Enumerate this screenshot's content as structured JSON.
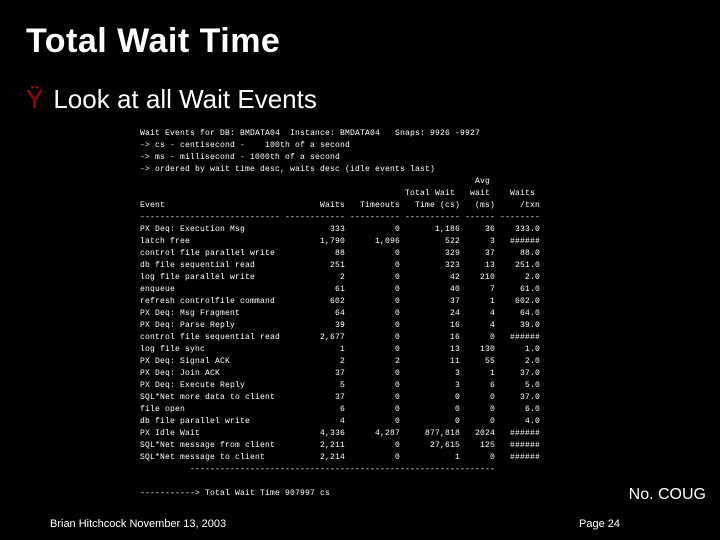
{
  "title": "Total Wait Time",
  "bullet": {
    "symbol": "Ÿ",
    "text": "Look at all Wait Events"
  },
  "report": {
    "header_lines": [
      "Wait Events for DB: BMDATA04  Instance: BMDATA04   Snaps: 9926 -9927",
      "-> cs - centisecond -    100th of a second",
      "-> ms - millisecond - 1000th of a second",
      "-> ordered by wait time desc, waits desc (idle events last)"
    ],
    "col_head1": "                                                                   Avg",
    "col_head2": "                                                     Total Wait   wait    Waits",
    "col_head3": "Event                               Waits   Timeouts   Time (cs)   (ms)     /txn",
    "col_sep": "---------------------------- ------------ ---------- ----------- ------ --------",
    "rows": [
      {
        "event": "PX Deq: Execution Msg",
        "waits": "333",
        "timeouts": "0",
        "total": "1,186",
        "avg": "36",
        "pertxn": "333.0"
      },
      {
        "event": "latch free",
        "waits": "1,790",
        "timeouts": "1,096",
        "total": "522",
        "avg": "3",
        "pertxn": "######"
      },
      {
        "event": "control file parallel write",
        "waits": "88",
        "timeouts": "0",
        "total": "329",
        "avg": "37",
        "pertxn": "88.0"
      },
      {
        "event": "db file sequential read",
        "waits": "251",
        "timeouts": "0",
        "total": "323",
        "avg": "13",
        "pertxn": "251.0"
      },
      {
        "event": "log file parallel write",
        "waits": "2",
        "timeouts": "0",
        "total": "42",
        "avg": "210",
        "pertxn": "2.0"
      },
      {
        "event": "enqueue",
        "waits": "61",
        "timeouts": "0",
        "total": "40",
        "avg": "7",
        "pertxn": "61.0"
      },
      {
        "event": "refresh controlfile command",
        "waits": "602",
        "timeouts": "0",
        "total": "37",
        "avg": "1",
        "pertxn": "602.0"
      },
      {
        "event": "PX Deq: Msg Fragment",
        "waits": "64",
        "timeouts": "0",
        "total": "24",
        "avg": "4",
        "pertxn": "64.0"
      },
      {
        "event": "PX Deq: Parse Reply",
        "waits": "39",
        "timeouts": "0",
        "total": "16",
        "avg": "4",
        "pertxn": "39.0"
      },
      {
        "event": "control file sequential read",
        "waits": "2,677",
        "timeouts": "0",
        "total": "16",
        "avg": "0",
        "pertxn": "######"
      },
      {
        "event": "log file sync",
        "waits": "1",
        "timeouts": "0",
        "total": "13",
        "avg": "130",
        "pertxn": "1.0"
      },
      {
        "event": "PX Deq: Signal ACK",
        "waits": "2",
        "timeouts": "2",
        "total": "11",
        "avg": "55",
        "pertxn": "2.0"
      },
      {
        "event": "PX Deq: Join ACK",
        "waits": "37",
        "timeouts": "0",
        "total": "3",
        "avg": "1",
        "pertxn": "37.0"
      },
      {
        "event": "PX Deq: Execute Reply",
        "waits": "5",
        "timeouts": "0",
        "total": "3",
        "avg": "6",
        "pertxn": "5.0"
      },
      {
        "event": "SQL*Net more data to client",
        "waits": "37",
        "timeouts": "0",
        "total": "0",
        "avg": "0",
        "pertxn": "37.0"
      },
      {
        "event": "file open",
        "waits": "6",
        "timeouts": "0",
        "total": "0",
        "avg": "0",
        "pertxn": "6.0"
      },
      {
        "event": "db file parallel write",
        "waits": "4",
        "timeouts": "0",
        "total": "0",
        "avg": "0",
        "pertxn": "4.0"
      },
      {
        "event": "PX Idle Wait",
        "waits": "4,336",
        "timeouts": "4,287",
        "total": "877,818",
        "avg": "2024",
        "pertxn": "######"
      },
      {
        "event": "SQL*Net message from client",
        "waits": "2,211",
        "timeouts": "0",
        "total": "27,615",
        "avg": "125",
        "pertxn": "######"
      },
      {
        "event": "SQL*Net message to client",
        "waits": "2,214",
        "timeouts": "0",
        "total": "1",
        "avg": "0",
        "pertxn": "######"
      }
    ],
    "sep2": "          -------------------------------------------------------------",
    "summary": "-----------> Total Wait Time 907997 cs"
  },
  "footer": {
    "right_tag": "No. COUG",
    "left": "Brian Hitchcock  November 13, 2003",
    "page": "Page 24"
  }
}
